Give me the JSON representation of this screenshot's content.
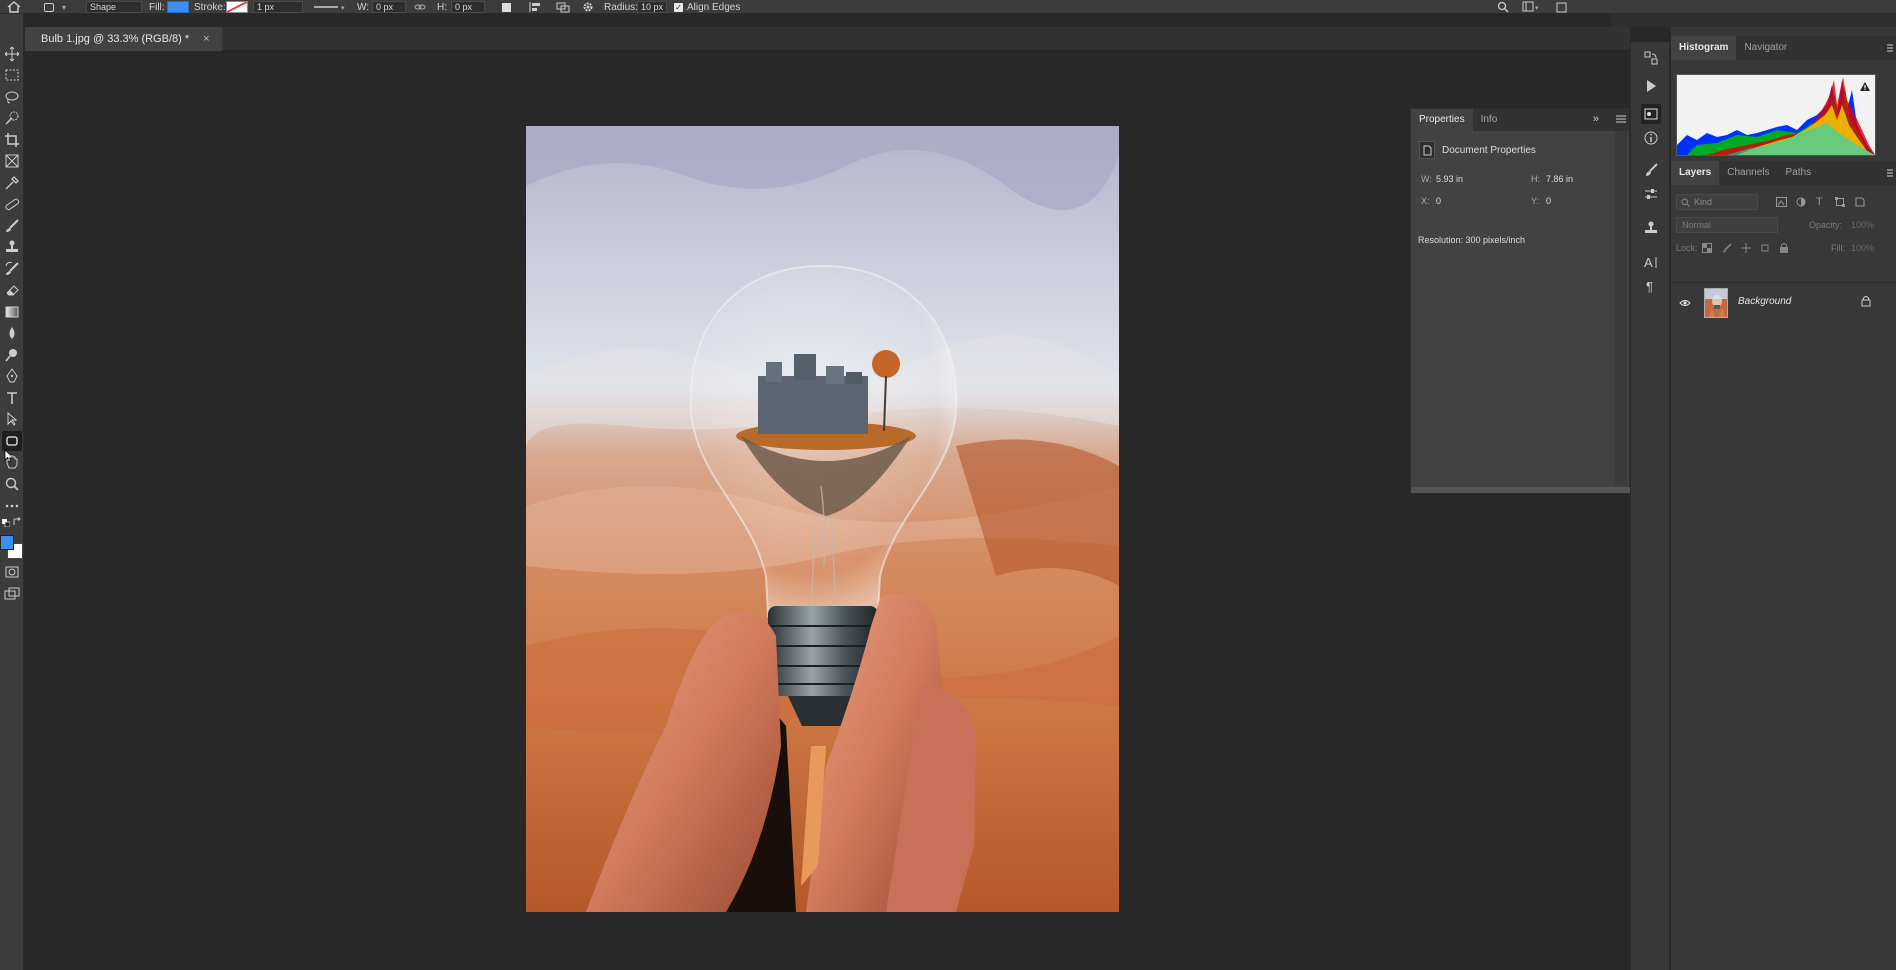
{
  "options_bar": {
    "mode_label": "Shape",
    "fill_label": "Fill:",
    "stroke_label": "Stroke:",
    "stroke_width": "1 px",
    "w_label": "W:",
    "w_value": "0 px",
    "link_icon": "link-icon",
    "h_label": "H:",
    "h_value": "0 px",
    "radius_label": "Radius:",
    "radius_value": "10 px",
    "align_edges_label": "Align Edges",
    "align_edges_checked": true,
    "fill_color": "#3b8ff0",
    "stroke_color": "#e04040"
  },
  "document_tab": {
    "title": "Bulb 1.jpg @ 33.3% (RGB/8) *",
    "close_glyph": "×"
  },
  "properties_panel": {
    "tabs": [
      "Properties",
      "Info"
    ],
    "active_tab": "Properties",
    "section_title": "Document Properties",
    "w_label": "W:",
    "w_value": "5.93 in",
    "h_label": "H:",
    "h_value": "7.86 in",
    "x_label": "X:",
    "x_value": "0",
    "y_label": "Y:",
    "y_value": "0",
    "resolution": "Resolution: 300 pixels/inch"
  },
  "histogram_panel": {
    "tabs": [
      "Histogram",
      "Navigator"
    ],
    "active_tab": "Histogram"
  },
  "layers_panel": {
    "tabs": [
      "Layers",
      "Channels",
      "Paths"
    ],
    "active_tab": "Layers",
    "kind_placeholder": "Kind",
    "blend_mode": "Normal",
    "opacity_label": "Opacity:",
    "opacity_value": "100%",
    "lock_label": "Lock:",
    "fill_label": "Fill:",
    "fill_value": "100%",
    "layers": [
      {
        "name": "Background",
        "visible": true,
        "locked": true
      }
    ]
  },
  "colors": {
    "foreground": "#3b8ff0",
    "background": "#ffffff"
  }
}
